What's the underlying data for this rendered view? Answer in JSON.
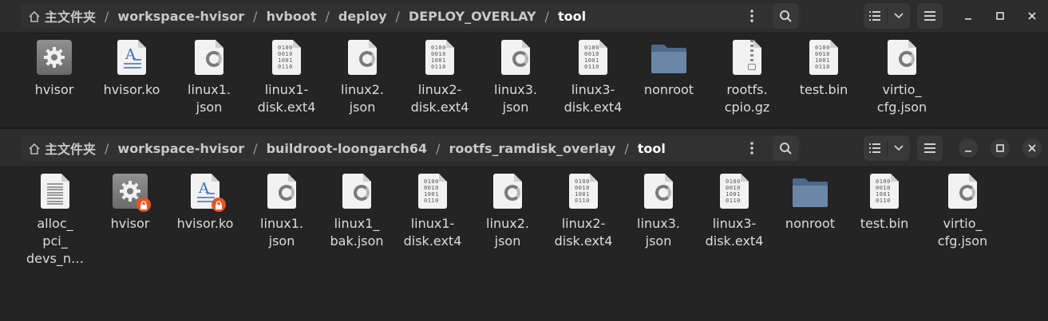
{
  "colors": {
    "accent": "#e95420",
    "folder": "#6a87a8",
    "background": "#242424",
    "headerbar": "#2c2c2c"
  },
  "icons": {
    "home": "home-icon",
    "menu": "vertical-dots-icon",
    "search": "search-icon",
    "list_view": "list-view-icon",
    "view_options": "chevron-down-icon",
    "hamburger": "hamburger-menu-icon",
    "minimize": "minimize-icon",
    "maximize": "maximize-icon",
    "close": "close-icon",
    "lock": "lock-icon"
  },
  "window1": {
    "breadcrumbs": [
      "主文件夹",
      "workspace-hvisor",
      "hvboot",
      "deploy",
      "DEPLOY_OVERLAY",
      "tool"
    ],
    "separator": "/",
    "files": [
      {
        "name": "hvisor",
        "type": "executable"
      },
      {
        "name": "hvisor.ko",
        "type": "ko"
      },
      {
        "name": "linux1.\njson",
        "type": "json"
      },
      {
        "name": "linux1-\ndisk.ext4",
        "type": "binary"
      },
      {
        "name": "linux2.\njson",
        "type": "json"
      },
      {
        "name": "linux2-\ndisk.ext4",
        "type": "binary"
      },
      {
        "name": "linux3.\njson",
        "type": "json"
      },
      {
        "name": "linux3-\ndisk.ext4",
        "type": "binary"
      },
      {
        "name": "nonroot",
        "type": "folder"
      },
      {
        "name": "rootfs.\ncpio.gz",
        "type": "archive"
      },
      {
        "name": "test.bin",
        "type": "binary"
      },
      {
        "name": "virtio_\ncfg.json",
        "type": "json"
      }
    ]
  },
  "window2": {
    "breadcrumbs": [
      "主文件夹",
      "workspace-hvisor",
      "buildroot-loongarch64",
      "rootfs_ramdisk_overlay",
      "tool"
    ],
    "separator": "/",
    "files": [
      {
        "name": "alloc_\npci_\ndevs_n…",
        "type": "text"
      },
      {
        "name": "hvisor",
        "type": "executable",
        "locked": true
      },
      {
        "name": "hvisor.ko",
        "type": "ko",
        "locked": true
      },
      {
        "name": "linux1.\njson",
        "type": "json"
      },
      {
        "name": "linux1_\nbak.json",
        "type": "json"
      },
      {
        "name": "linux1-\ndisk.ext4",
        "type": "binary"
      },
      {
        "name": "linux2.\njson",
        "type": "json"
      },
      {
        "name": "linux2-\ndisk.ext4",
        "type": "binary"
      },
      {
        "name": "linux3.\njson",
        "type": "json"
      },
      {
        "name": "linux3-\ndisk.ext4",
        "type": "binary"
      },
      {
        "name": "nonroot",
        "type": "folder"
      },
      {
        "name": "test.bin",
        "type": "binary"
      },
      {
        "name": "virtio_\ncfg.json",
        "type": "json"
      }
    ]
  },
  "binary_glyph": "0100\n0010\n1001\n0110"
}
